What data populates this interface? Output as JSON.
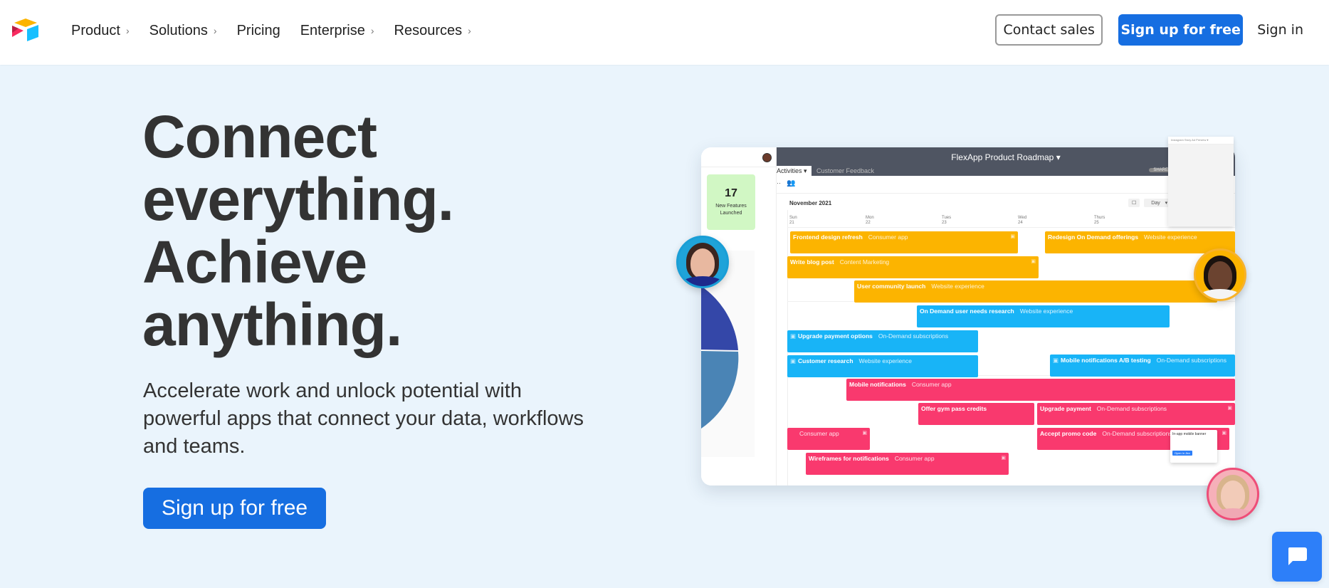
{
  "nav": {
    "brand": "Airtable",
    "items": [
      {
        "label": "Product",
        "has_chevron": true
      },
      {
        "label": "Solutions",
        "has_chevron": true
      },
      {
        "label": "Pricing",
        "has_chevron": false
      },
      {
        "label": "Enterprise",
        "has_chevron": true
      },
      {
        "label": "Resources",
        "has_chevron": true
      }
    ],
    "contact_sales": "Contact sales",
    "signup": "Sign up for free",
    "signin": "Sign in"
  },
  "hero": {
    "title_lines": [
      "Connect",
      "everything.",
      "Achieve",
      "anything."
    ],
    "subtitle": "Accelerate work and unlock potential with powerful apps that connect your data, workflows and teams.",
    "cta": "Sign up for free"
  },
  "mockup": {
    "stat_number": "17",
    "stat_label": "New Features Launched",
    "base_title": "FlexApp Product Roadmap",
    "tabs": [
      "Activities",
      "Customer Feedback"
    ],
    "share_label": "SHARE",
    "month": "November 2021",
    "view_label": "Day",
    "days": [
      {
        "name": "Sun",
        "date": "21"
      },
      {
        "name": "Mon",
        "date": "22"
      },
      {
        "name": "Tues",
        "date": "23"
      },
      {
        "name": "Wed",
        "date": "24"
      },
      {
        "name": "Thurs",
        "date": "25"
      }
    ],
    "panel_title": "Instagram Story Ad Preview",
    "popup_title": "In-app mobile banner",
    "popup_button": "Open in Jira",
    "tasks": [
      {
        "title": "Frontend design refresh",
        "tag": "Consumer app",
        "color": "yellow"
      },
      {
        "title": "Redesign On Demand offerings",
        "tag": "Website experience",
        "color": "yellow"
      },
      {
        "title": "Write blog post",
        "tag": "Content Marketing",
        "color": "yellow"
      },
      {
        "title": "User community launch",
        "tag": "Website experience",
        "color": "yellow"
      },
      {
        "title": "On Demand user needs research",
        "tag": "Website experience",
        "color": "blue"
      },
      {
        "title": "Upgrade payment options",
        "tag": "On-Demand subscriptions",
        "color": "blue"
      },
      {
        "title": "Customer research",
        "tag": "Website experience",
        "color": "blue"
      },
      {
        "title": "Mobile notifications A/B testing",
        "tag": "On-Demand subscriptions",
        "color": "blue"
      },
      {
        "title": "Mobile notifications",
        "tag": "Consumer app",
        "color": "pink"
      },
      {
        "title": "Offer gym pass credits",
        "tag": "",
        "color": "pink"
      },
      {
        "title": "Upgrade payment",
        "tag": "On-Demand subscriptions",
        "color": "pink"
      },
      {
        "title": "",
        "tag": "Consumer app",
        "color": "pink"
      },
      {
        "title": "Accept promo code",
        "tag": "On-Demand subscriptions",
        "color": "pink"
      },
      {
        "title": "Wireframes for notifications",
        "tag": "Consumer app",
        "color": "pink"
      }
    ]
  },
  "colors": {
    "brand_blue": "#166ee1",
    "background": "#eaf4fc",
    "yellow": "#fcb400",
    "blue": "#18b4f7",
    "pink": "#f9396e"
  }
}
